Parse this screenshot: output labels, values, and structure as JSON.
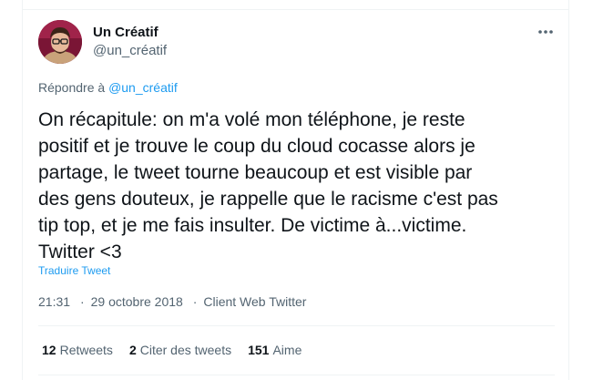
{
  "author": {
    "name": "Un Créatif",
    "handle": "@un_créatif"
  },
  "reply": {
    "prefix": "Répondre à ",
    "handle": "@un_créatif"
  },
  "tweet": {
    "text": "On récapitule: on m'a volé mon téléphone, je reste\npositif et je trouve le coup du cloud cocasse alors je\npartage, le tweet tourne beaucoup et est visible par\ndes gens douteux, je rappelle que le racisme c'est pas\ntip top, et je me fais insulter. De victime à...victime.\nTwitter <3",
    "translate_label": "Traduire Tweet"
  },
  "meta": {
    "time": "21:31",
    "date": "29 octobre 2018",
    "source": "Client Web Twitter",
    "separator": "·"
  },
  "stats": {
    "retweets_count": "12",
    "retweets_label": "Retweets",
    "quotes_count": "2",
    "quotes_label": "Citer des tweets",
    "likes_count": "151",
    "likes_label": "Aime"
  },
  "colors": {
    "accent": "#1d9bf0",
    "text": "#0f1419",
    "secondary": "#536471",
    "border": "#eff3f4"
  },
  "icons": {
    "more": "more-horizontal-icon",
    "avatar": "avatar-photo"
  }
}
